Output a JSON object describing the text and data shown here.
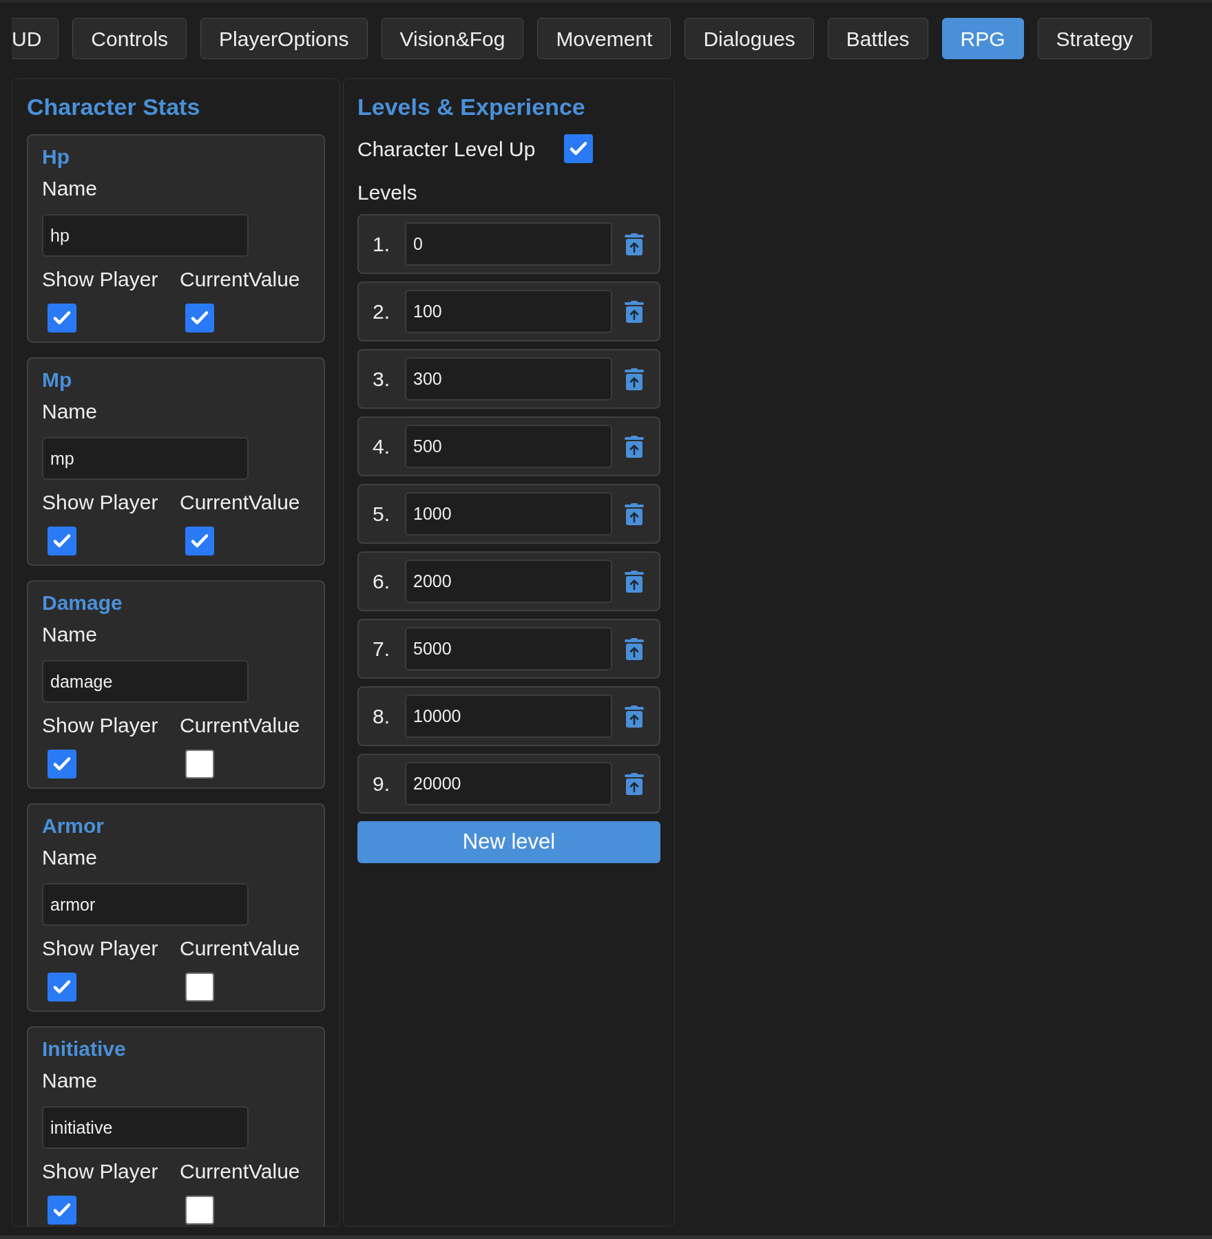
{
  "tabs": [
    {
      "label": "UD",
      "selected": false
    },
    {
      "label": "Controls",
      "selected": false
    },
    {
      "label": "PlayerOptions",
      "selected": false
    },
    {
      "label": "Vision&Fog",
      "selected": false
    },
    {
      "label": "Movement",
      "selected": false
    },
    {
      "label": "Dialogues",
      "selected": false
    },
    {
      "label": "Battles",
      "selected": false
    },
    {
      "label": "RPG",
      "selected": true
    },
    {
      "label": "Strategy",
      "selected": false
    }
  ],
  "character_stats": {
    "title": "Character Stats",
    "stats": [
      {
        "title": "Hp",
        "name_label": "Name",
        "name_value": "hp",
        "show_player_label": "Show Player",
        "show_player": true,
        "current_value_label": "CurrentValue",
        "current_value": true
      },
      {
        "title": "Mp",
        "name_label": "Name",
        "name_value": "mp",
        "show_player_label": "Show Player",
        "show_player": true,
        "current_value_label": "CurrentValue",
        "current_value": true
      },
      {
        "title": "Damage",
        "name_label": "Name",
        "name_value": "damage",
        "show_player_label": "Show Player",
        "show_player": true,
        "current_value_label": "CurrentValue",
        "current_value": false
      },
      {
        "title": "Armor",
        "name_label": "Name",
        "name_value": "armor",
        "show_player_label": "Show Player",
        "show_player": true,
        "current_value_label": "CurrentValue",
        "current_value": false
      },
      {
        "title": "Initiative",
        "name_label": "Name",
        "name_value": "initiative",
        "show_player_label": "Show Player",
        "show_player": true,
        "current_value_label": "CurrentValue",
        "current_value": false
      }
    ]
  },
  "levels_panel": {
    "title": "Levels & Experience",
    "level_up_label": "Character Level Up",
    "level_up": true,
    "levels_label": "Levels",
    "levels": [
      {
        "number": "1.",
        "value": "0"
      },
      {
        "number": "2.",
        "value": "100"
      },
      {
        "number": "3.",
        "value": "300"
      },
      {
        "number": "4.",
        "value": "500"
      },
      {
        "number": "5.",
        "value": "1000"
      },
      {
        "number": "6.",
        "value": "2000"
      },
      {
        "number": "7.",
        "value": "5000"
      },
      {
        "number": "8.",
        "value": "10000"
      },
      {
        "number": "9.",
        "value": "20000"
      }
    ],
    "new_level_button": "New level"
  }
}
